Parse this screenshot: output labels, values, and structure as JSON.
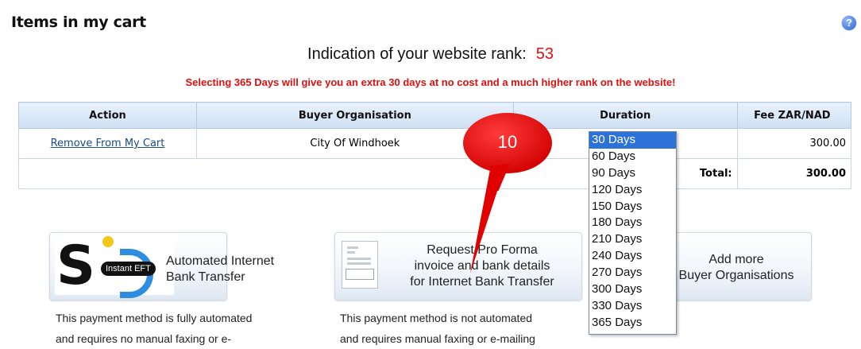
{
  "header": {
    "title": "Items in my cart",
    "help_icon": "?"
  },
  "rank": {
    "label": "Indication of your website rank:",
    "value": "53"
  },
  "promo": "Selecting 365 Days will give you an extra 30 days at no cost and a much higher rank on the website!",
  "table": {
    "headers": {
      "action": "Action",
      "buyer": "Buyer Organisation",
      "duration": "Duration",
      "fee": "Fee ZAR/NAD"
    },
    "rows": [
      {
        "action": "Remove From My Cart",
        "buyer": "City Of Windhoek",
        "duration": "30 Days",
        "fee": "300.00"
      }
    ],
    "total_label": "Total:",
    "total_value": "300.00"
  },
  "duration_options": [
    "30 Days",
    "60 Days",
    "90 Days",
    "120 Days",
    "150 Days",
    "180 Days",
    "210 Days",
    "240 Days",
    "270 Days",
    "300 Days",
    "330 Days",
    "365 Days"
  ],
  "payment": {
    "eft": {
      "badge": "Instant EFT",
      "line1": "Automated Internet",
      "line2": "Bank Transfer",
      "description_line1": "This payment method is fully automated",
      "description_line2": "and requires no manual faxing or e-"
    },
    "proforma": {
      "line1": "Request Pro Forma",
      "line2": "invoice and bank details",
      "line3": "for Internet Bank Transfer",
      "description_line1": "This payment method is not automated",
      "description_line2": "and requires manual faxing or e-mailing"
    },
    "add": {
      "line1": "Add more",
      "line2": "Buyer Organisations"
    }
  },
  "annotation": {
    "number": "10"
  },
  "colors": {
    "accent_red": "#e01010",
    "link_blue": "#1a4a8a",
    "selected_blue": "#2d72d9"
  }
}
